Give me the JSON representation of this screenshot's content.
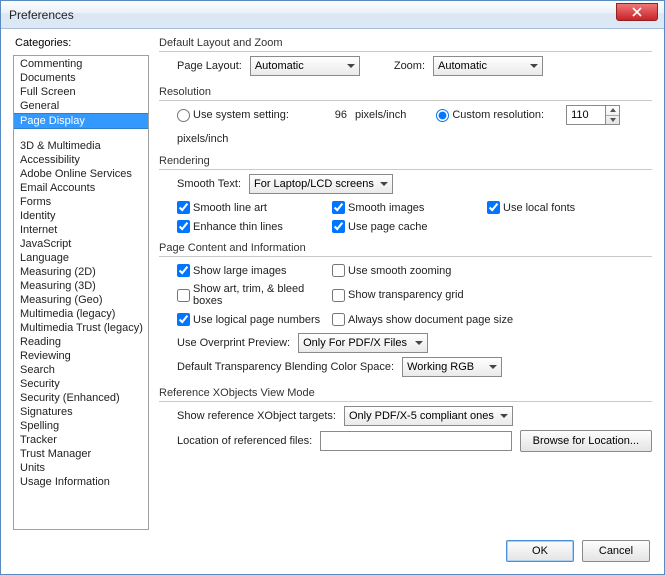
{
  "window": {
    "title": "Preferences"
  },
  "left": {
    "label": "Categories:",
    "items_top": [
      "Commenting",
      "Documents",
      "Full Screen",
      "General",
      "Page Display"
    ],
    "selected": "Page Display",
    "items_bottom": [
      "3D & Multimedia",
      "Accessibility",
      "Adobe Online Services",
      "Email Accounts",
      "Forms",
      "Identity",
      "Internet",
      "JavaScript",
      "Language",
      "Measuring (2D)",
      "Measuring (3D)",
      "Measuring (Geo)",
      "Multimedia (legacy)",
      "Multimedia Trust (legacy)",
      "Reading",
      "Reviewing",
      "Search",
      "Security",
      "Security (Enhanced)",
      "Signatures",
      "Spelling",
      "Tracker",
      "Trust Manager",
      "Units",
      "Usage Information"
    ]
  },
  "layoutZoom": {
    "title": "Default Layout and Zoom",
    "pageLayoutLabel": "Page Layout:",
    "pageLayoutValue": "Automatic",
    "zoomLabel": "Zoom:",
    "zoomValue": "Automatic"
  },
  "resolution": {
    "title": "Resolution",
    "useSystemLabel": "Use system setting:",
    "systemValue": "96",
    "unit": "pixels/inch",
    "customLabel": "Custom resolution:",
    "customValue": "110"
  },
  "rendering": {
    "title": "Rendering",
    "smoothTextLabel": "Smooth Text:",
    "smoothTextValue": "For Laptop/LCD screens",
    "smoothLineArt": "Smooth line art",
    "smoothImages": "Smooth images",
    "useLocalFonts": "Use local fonts",
    "enhanceThin": "Enhance thin lines",
    "usePageCache": "Use page cache"
  },
  "pageContent": {
    "title": "Page Content and Information",
    "showLargeImages": "Show large images",
    "useSmoothZooming": "Use smooth zooming",
    "showArtTrim": "Show art, trim, & bleed boxes",
    "showTransGrid": "Show transparency grid",
    "useLogicalPageNums": "Use logical page numbers",
    "alwaysShowDocSize": "Always show document page size",
    "overprintLabel": "Use Overprint Preview:",
    "overprintValue": "Only For PDF/X Files",
    "blendLabel": "Default Transparency Blending Color Space:",
    "blendValue": "Working RGB"
  },
  "refXObjects": {
    "title": "Reference XObjects View Mode",
    "showRefLabel": "Show reference XObject targets:",
    "showRefValue": "Only PDF/X-5 compliant ones",
    "locationLabel": "Location of referenced files:",
    "locationValue": "",
    "browseLabel": "Browse for Location..."
  },
  "footer": {
    "ok": "OK",
    "cancel": "Cancel"
  }
}
